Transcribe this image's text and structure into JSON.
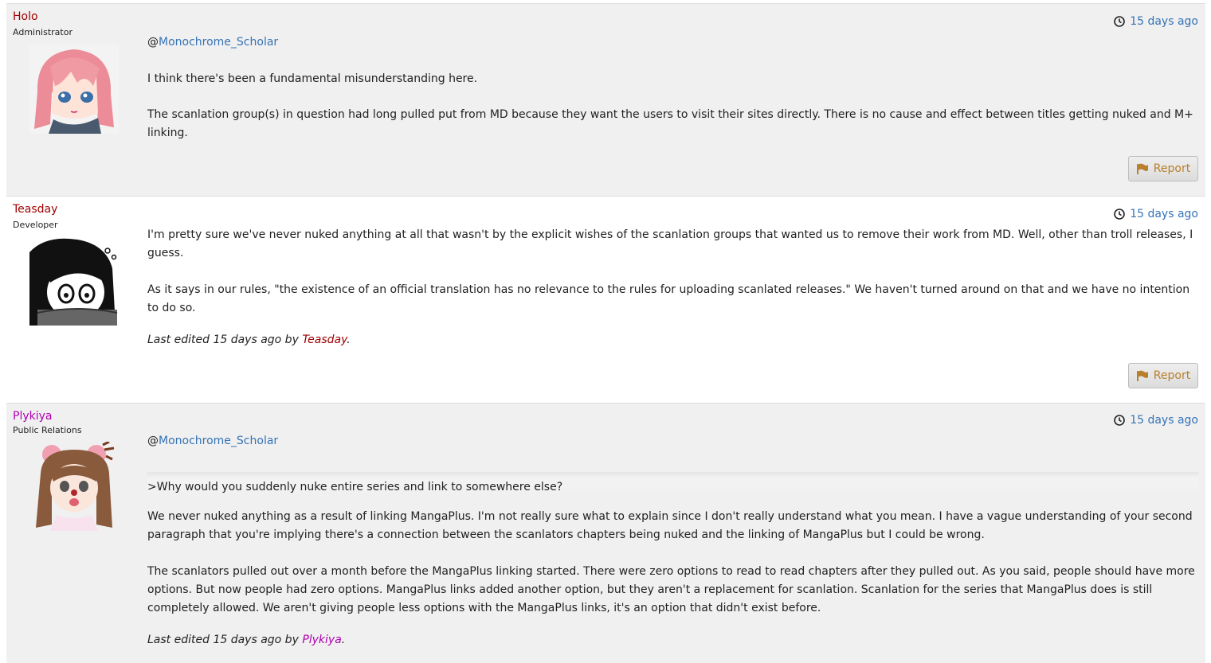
{
  "posts": [
    {
      "username": "Holo",
      "username_color": "#a00000",
      "role": "Administrator",
      "time": "15 days ago",
      "mention_at": "@",
      "mention": "Monochrome_Scholar",
      "paragraphs": [
        "I think there's been a fundamental misunderstanding here.",
        "The scanlation group(s) in question had long pulled put from MD because they want the users to visit their sites directly. There is no cause and effect between titles getting nuked and M+ linking."
      ],
      "report_label": "Report"
    },
    {
      "username": "Teasday",
      "username_color": "#a00000",
      "role": "Developer",
      "time": "15 days ago",
      "paragraphs": [
        "I'm pretty sure we've never nuked anything at all that wasn't by the explicit wishes of the scanlation groups that wanted us to remove their work from MD. Well, other than troll releases, I guess.",
        "As it says in our rules, \"the existence of an official translation has no relevance to the rules for uploading scanlated releases.\" We haven't turned around on that and we have no intention to do so."
      ],
      "edited_prefix": "Last edited 15 days ago by ",
      "edited_by": "Teasday",
      "edited_suffix": ".",
      "report_label": "Report"
    },
    {
      "username": "Plykiya",
      "username_color": "#b000b0",
      "role": "Public Relations",
      "time": "15 days ago",
      "mention_at": "@",
      "mention": "Monochrome_Scholar",
      "quote": ">Why would you suddenly nuke entire series and link to somewhere else?",
      "paragraphs": [
        "We never nuked anything as a result of linking MangaPlus. I'm not really sure what to explain since I don't really understand what you mean. I have a vague understanding of your second paragraph that you're implying there's a connection between the scanlators chapters being nuked and the linking of MangaPlus but I could be wrong.",
        "The scanlators pulled out over a month before the MangaPlus linking started. There were zero options to read to read chapters after they pulled out. As you said, people should have more options. But now people had zero options. MangaPlus links added another option, but they aren't a replacement for scanlation. Scanlation for the series that MangaPlus does is still completely allowed. We aren't giving people less options with the MangaPlus links, it's an option that didn't exist before."
      ],
      "edited_prefix": "Last edited 15 days ago by ",
      "edited_by": "Plykiya",
      "edited_suffix": "."
    }
  ],
  "icons": {
    "clock": "clock-icon",
    "flag": "flag-icon"
  },
  "colors": {
    "link": "#3673b5",
    "report_text": "#b8802d",
    "post_gray": "#f0f0f0"
  }
}
